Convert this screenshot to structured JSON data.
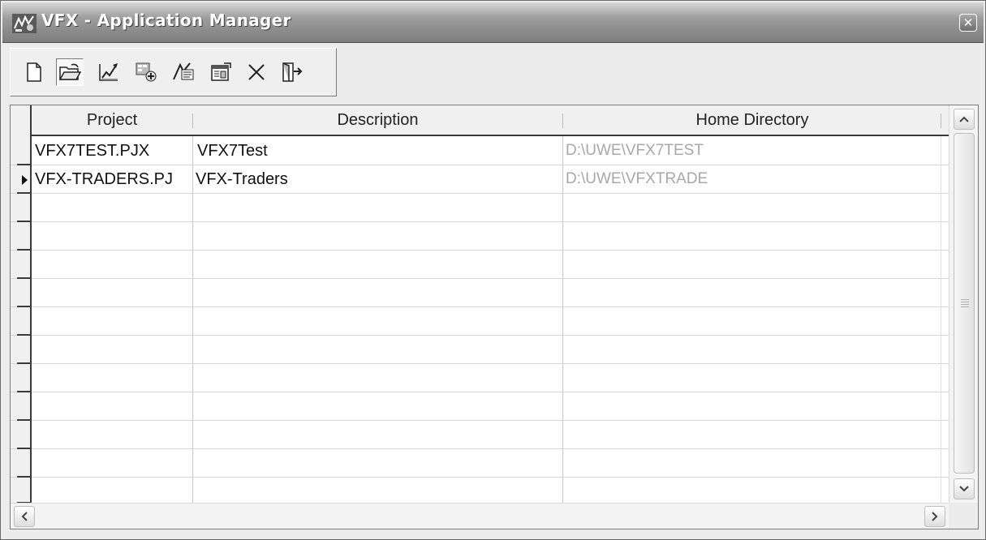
{
  "window": {
    "title": "VFX - Application Manager",
    "close_icon": "close-icon"
  },
  "toolbar": {
    "buttons": [
      {
        "name": "new-icon"
      },
      {
        "name": "open-folder-icon"
      },
      {
        "name": "edit-chart-icon"
      },
      {
        "name": "add-module-icon"
      },
      {
        "name": "edit-text-icon"
      },
      {
        "name": "properties-icon"
      },
      {
        "name": "delete-icon"
      },
      {
        "name": "exit-door-icon"
      }
    ]
  },
  "grid": {
    "columns": [
      "Project",
      "Description",
      "Home Directory"
    ],
    "rows": [
      {
        "project": "VFX7TEST.PJX",
        "description": "VFX7Test",
        "home_directory": "D:\\UWE\\VFX7TEST"
      },
      {
        "project": "VFX-TRADERS.PJ",
        "description": "VFX-Traders",
        "home_directory": "D:\\UWE\\VFXTRADE"
      }
    ],
    "current_row": 1
  }
}
